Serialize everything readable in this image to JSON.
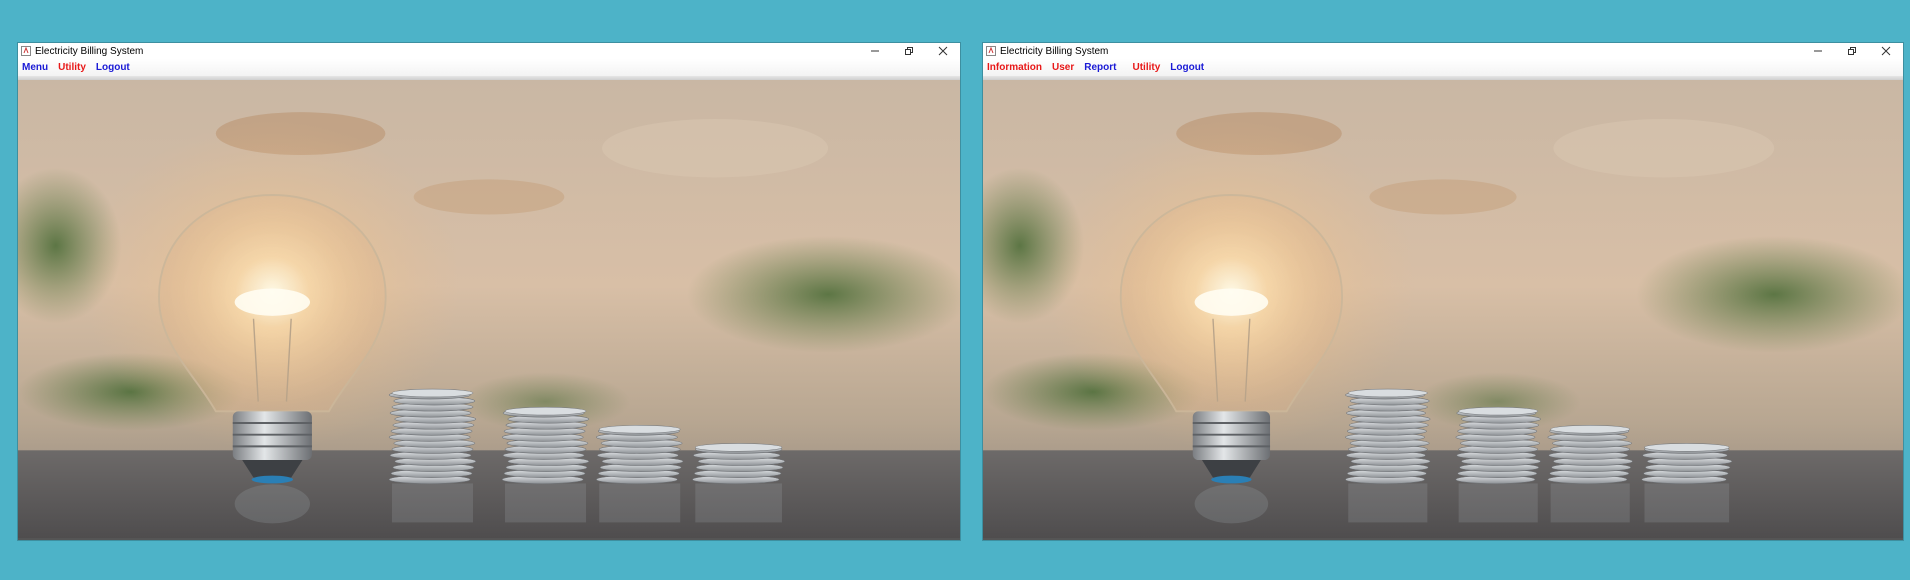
{
  "windows": [
    {
      "id": "left",
      "title": "Electricity Billing System",
      "menu": [
        {
          "label": "Menu",
          "color": "#1a1ad6"
        },
        {
          "label": "Utility",
          "color": "#e81919"
        },
        {
          "label": "Logout",
          "color": "#1a1ad6"
        }
      ]
    },
    {
      "id": "right",
      "title": "Electricity Billing System",
      "menu": [
        {
          "label": "Information",
          "color": "#e81919"
        },
        {
          "label": "User",
          "color": "#e81919"
        },
        {
          "label": "Report",
          "color": "#1a1ad6"
        },
        {
          "label": "Utility",
          "color": "#e81919"
        },
        {
          "label": "Logout",
          "color": "#1a1ad6"
        }
      ]
    }
  ],
  "background_image": "lightbulb-and-coins-photo",
  "colors": {
    "desktop": "#4db3c8",
    "menu_blue": "#1a1ad6",
    "menu_red": "#e81919"
  }
}
